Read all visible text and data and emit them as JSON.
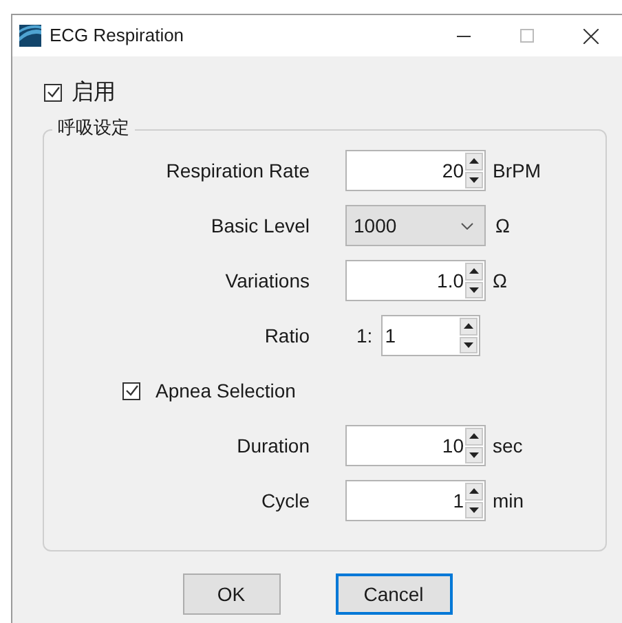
{
  "window": {
    "title": "ECG Respiration"
  },
  "enable": {
    "label": "启用",
    "checked": true
  },
  "group": {
    "title": "呼吸设定",
    "rows": [
      {
        "kind": "spin",
        "label": "Respiration Rate",
        "value": "20",
        "unit": "BrPM"
      },
      {
        "kind": "select",
        "label": "Basic Level",
        "value": "1000",
        "unit": "Ω"
      },
      {
        "kind": "spin",
        "label": "Variations",
        "value": "1.0",
        "unit": "Ω"
      },
      {
        "kind": "ratio",
        "label": "Ratio",
        "prefix": "1:",
        "value": "1"
      },
      {
        "kind": "checkbox",
        "label": "Apnea Selection",
        "checked": true
      },
      {
        "kind": "spin",
        "label": "Duration",
        "value": "10",
        "unit": "sec"
      },
      {
        "kind": "spin",
        "label": "Cycle",
        "value": "1",
        "unit": "min"
      }
    ]
  },
  "buttons": [
    {
      "label": "OK",
      "selected": false
    },
    {
      "label": "Cancel",
      "selected": true
    }
  ]
}
